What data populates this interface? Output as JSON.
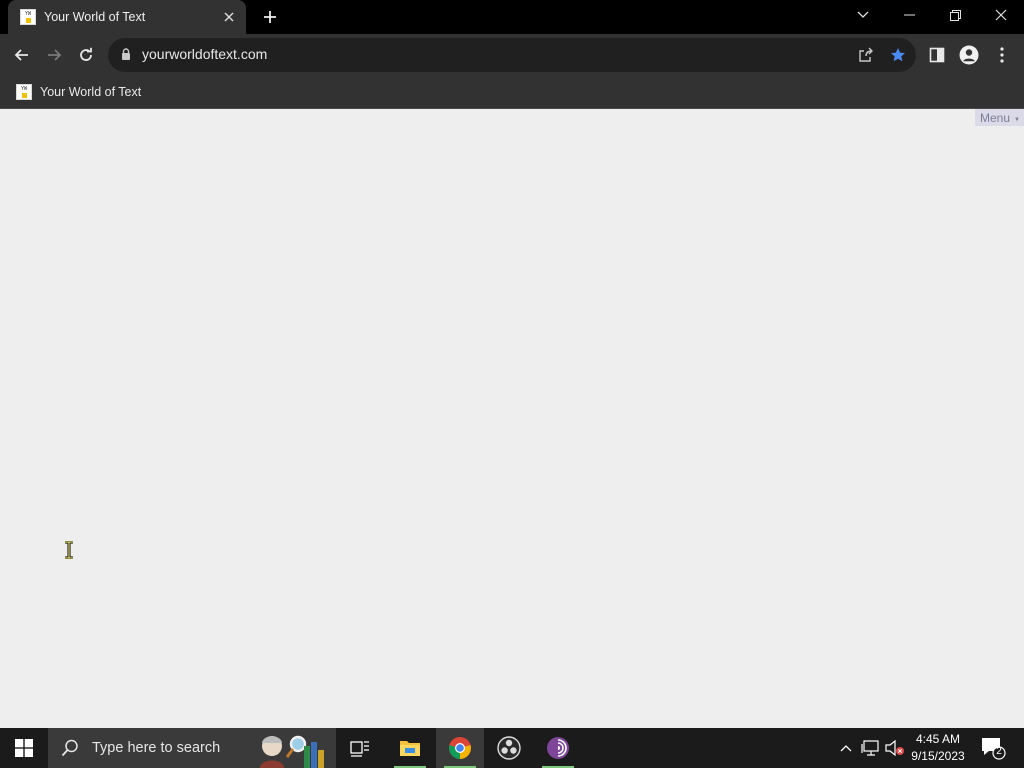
{
  "browser": {
    "tab": {
      "title": "Your World of Text",
      "favicon_text_top": "YW",
      "favicon_text_bottom": "OT"
    },
    "address": {
      "url": "yourworldoftext.com"
    },
    "bookmarks": [
      {
        "label": "Your World of Text"
      }
    ],
    "accent_color": "#3b82f6"
  },
  "page": {
    "menu_label": "Menu",
    "menu_caret": "▼",
    "background_color": "#eeeeee"
  },
  "taskbar": {
    "search_placeholder": "Type here to search",
    "apps": [
      "task-view",
      "file-explorer",
      "chrome",
      "obs-studio",
      "tor-browser"
    ],
    "active_app": "chrome",
    "time": "4:45 AM",
    "date": "9/15/2023",
    "notification_count": "2"
  }
}
